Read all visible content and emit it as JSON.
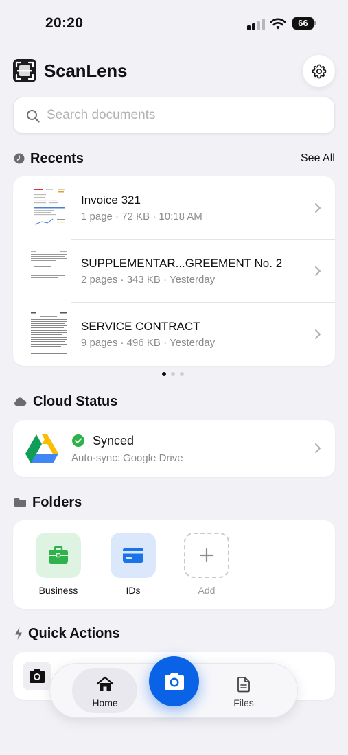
{
  "status_bar": {
    "time": "20:20",
    "battery": "66"
  },
  "header": {
    "app_name": "ScanLens",
    "settings_icon": "gear-icon"
  },
  "search": {
    "placeholder": "Search documents"
  },
  "recents": {
    "title": "Recents",
    "see_all": "See All",
    "items": [
      {
        "title": "Invoice 321",
        "meta": "1 page · 72 KB · 10:18 AM"
      },
      {
        "title": "SUPPLEMENTAR...GREEMENT No. 2",
        "meta": "2 pages · 343 KB · Yesterday"
      },
      {
        "title": "SERVICE CONTRACT",
        "meta": "9 pages · 496 KB · Yesterday"
      }
    ],
    "page_indicator": {
      "count": 3,
      "active": 0
    }
  },
  "cloud": {
    "title": "Cloud Status",
    "status": "Synced",
    "subtitle": "Auto-sync: Google Drive",
    "status_color": "#2fb24c"
  },
  "folders": {
    "title": "Folders",
    "items": [
      {
        "label": "Business",
        "icon": "briefcase-icon",
        "tile_color": "#dff3e3",
        "icon_color": "#2fb24c"
      },
      {
        "label": "IDs",
        "icon": "id-card-icon",
        "tile_color": "#dbe8fb",
        "icon_color": "#1a73e8"
      },
      {
        "label": "Add",
        "icon": "plus-icon"
      }
    ]
  },
  "quick_actions": {
    "title": "Quick Actions"
  },
  "tab_bar": {
    "home": "Home",
    "files": "Files",
    "scan_icon": "camera-icon",
    "accent": "#0a63e6"
  }
}
